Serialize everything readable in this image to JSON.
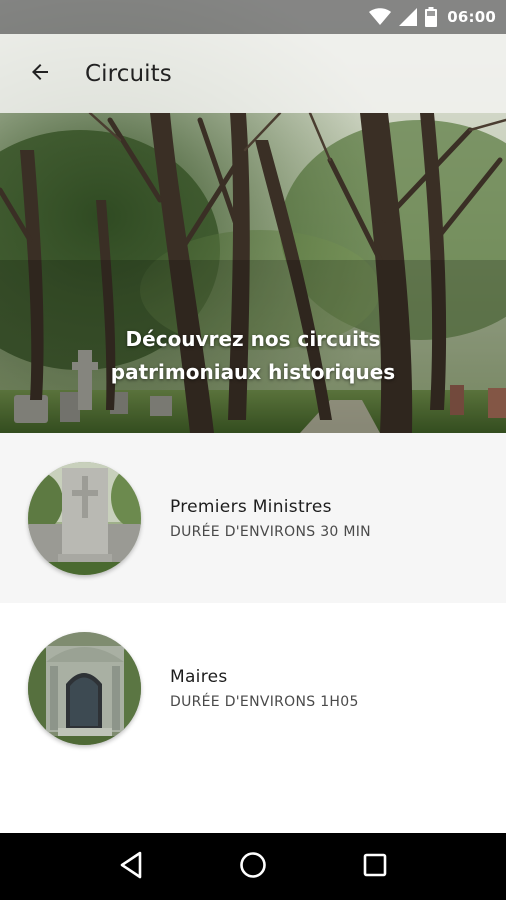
{
  "status_bar": {
    "time": "06:00",
    "icons": [
      "wifi-icon",
      "signal-icon",
      "battery-icon"
    ]
  },
  "toolbar": {
    "title": "Circuits",
    "back_icon": "arrow-back-icon"
  },
  "hero": {
    "caption_line1": "Découvrez nos circuits",
    "caption_line2": "patrimoniaux historiques"
  },
  "circuits": [
    {
      "name": "Premiers Ministres",
      "duration": "DURÉE D'ENVIRONS 30 MIN"
    },
    {
      "name": "Maires",
      "duration": "DURÉE D'ENVIRONS 1H05"
    }
  ],
  "nav": {
    "back": "nav-back-icon",
    "home": "nav-home-icon",
    "recents": "nav-recents-icon"
  },
  "colors": {
    "row_alt_bg": "#f6f6f6",
    "nav_bg": "#000000",
    "toolbar_bg": "#f2f2f0"
  }
}
